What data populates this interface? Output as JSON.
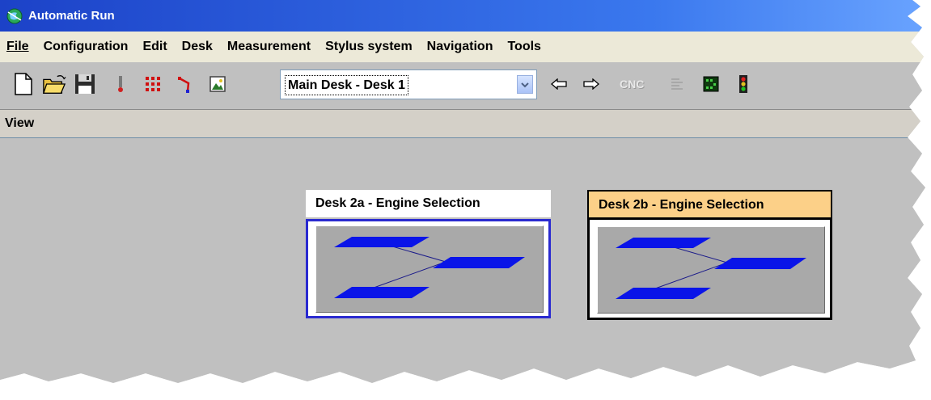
{
  "window": {
    "title": "Automatic Run"
  },
  "menu": {
    "items": [
      {
        "label": "File"
      },
      {
        "label": "Configuration"
      },
      {
        "label": "Edit"
      },
      {
        "label": "Desk"
      },
      {
        "label": "Measurement"
      },
      {
        "label": "Stylus system"
      },
      {
        "label": "Navigation"
      },
      {
        "label": "Tools"
      }
    ]
  },
  "toolbar": {
    "desk_select": "Main Desk - Desk 1",
    "cnc_label": "CNC",
    "icons": [
      "new-file-icon",
      "open-folder-icon",
      "save-icon",
      "probe-icon",
      "grid-icon",
      "path-icon",
      "image-icon",
      "back-arrow-icon",
      "forward-arrow-icon",
      "cnc-icon",
      "list-icon",
      "chip-icon",
      "traffic-light-icon"
    ]
  },
  "view": {
    "label": "View"
  },
  "desks": [
    {
      "title": "Desk 2a - Engine Selection",
      "selected": false,
      "title_color": "#ffffff",
      "frame_color": "#2a2ad0"
    },
    {
      "title": "Desk 2b - Engine Selection",
      "selected": true,
      "title_color": "#fcd088",
      "frame_color": "#000000"
    }
  ],
  "colors": {
    "titlebar": "#1c42c8",
    "node_blue": "#0a14e8",
    "desk_bg": "#a9a9a9"
  }
}
